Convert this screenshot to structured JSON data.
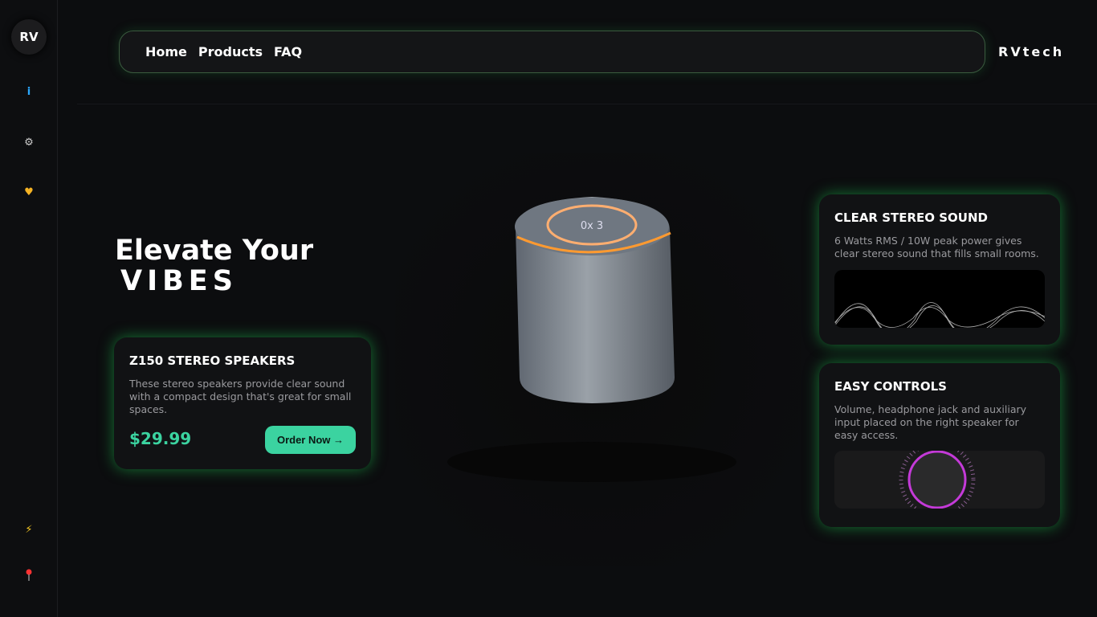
{
  "sidebar": {
    "logo": "RV",
    "icons": [
      "info-icon",
      "gear-icon",
      "heart-hands-icon",
      "lightning-icon",
      "pin-icon"
    ],
    "info_glyph": "i"
  },
  "nav": {
    "links": [
      "Home",
      "Products",
      "FAQ"
    ],
    "brand": "RVtech"
  },
  "hero": {
    "line1": "Elevate Your",
    "line2": "VIBES"
  },
  "product_card": {
    "title": "Z150 STEREO SPEAKERS",
    "description": "These stereo speakers provide clear sound with a compact design that's great for small spaces.",
    "price": "$29.99",
    "button": "Order Now →"
  },
  "product_image": {
    "display_text": "0x 3"
  },
  "features": [
    {
      "title": "CLEAR STEREO SOUND",
      "description": "6 Watts RMS / 10W peak power gives clear stereo sound that fills small rooms."
    },
    {
      "title": "EASY CONTROLS",
      "description": "Volume, headphone jack and auxiliary input placed on the right speaker for easy access."
    }
  ],
  "colors": {
    "accent": "#3bd3a0",
    "glow": "#1ec850",
    "knob": "#c43ad8"
  }
}
